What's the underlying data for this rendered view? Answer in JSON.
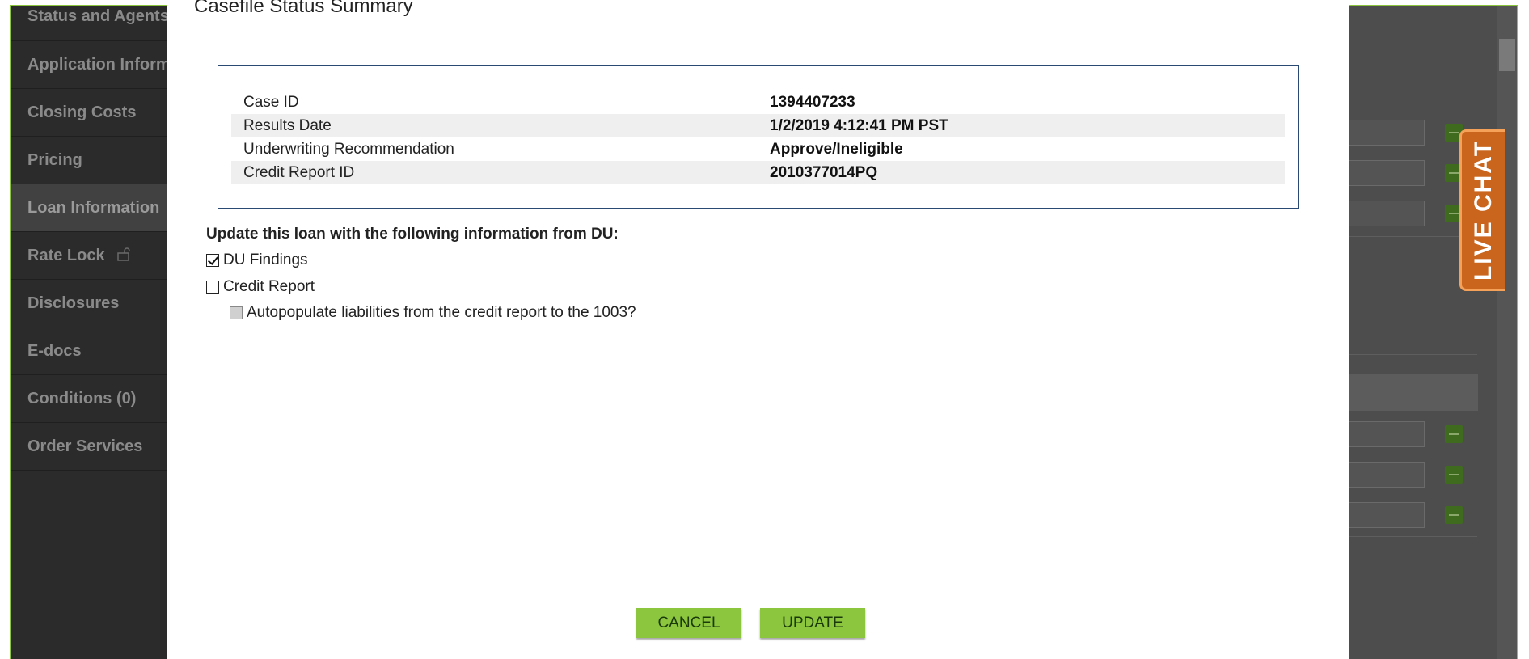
{
  "sidebar": {
    "items": [
      {
        "label": "Status and Agents"
      },
      {
        "label": "Application Information"
      },
      {
        "label": "Closing Costs"
      },
      {
        "label": "Pricing"
      },
      {
        "label": "Loan Information"
      },
      {
        "label": "Rate Lock"
      },
      {
        "label": "Disclosures"
      },
      {
        "label": "E-docs"
      },
      {
        "label": "Conditions (0)"
      },
      {
        "label": "Order Services"
      }
    ]
  },
  "live_chat": {
    "label": "LIVE CHAT"
  },
  "modal": {
    "title": "Casefile Status Summary",
    "summary": [
      {
        "label": "Case ID",
        "value": "1394407233"
      },
      {
        "label": "Results Date",
        "value": "1/2/2019 4:12:41 PM PST"
      },
      {
        "label": "Underwriting Recommendation",
        "value": "Approve/Ineligible"
      },
      {
        "label": "Credit Report ID",
        "value": "2010377014PQ"
      }
    ],
    "update_heading": "Update this loan with the following information from DU:",
    "options": {
      "du_findings": {
        "label": "DU Findings",
        "checked": true
      },
      "credit_report": {
        "label": "Credit Report",
        "checked": false
      },
      "autopopulate": {
        "label": "Autopopulate liabilities from the credit report to the 1003?",
        "checked": false,
        "disabled": true
      }
    },
    "cancel_label": "CANCEL",
    "update_label": "UPDATE"
  },
  "colors": {
    "accent_green": "#8cc63f",
    "live_chat_orange": "#c9651d",
    "sidebar_bg": "#2b2b2b",
    "summary_border": "#2a4a73"
  }
}
